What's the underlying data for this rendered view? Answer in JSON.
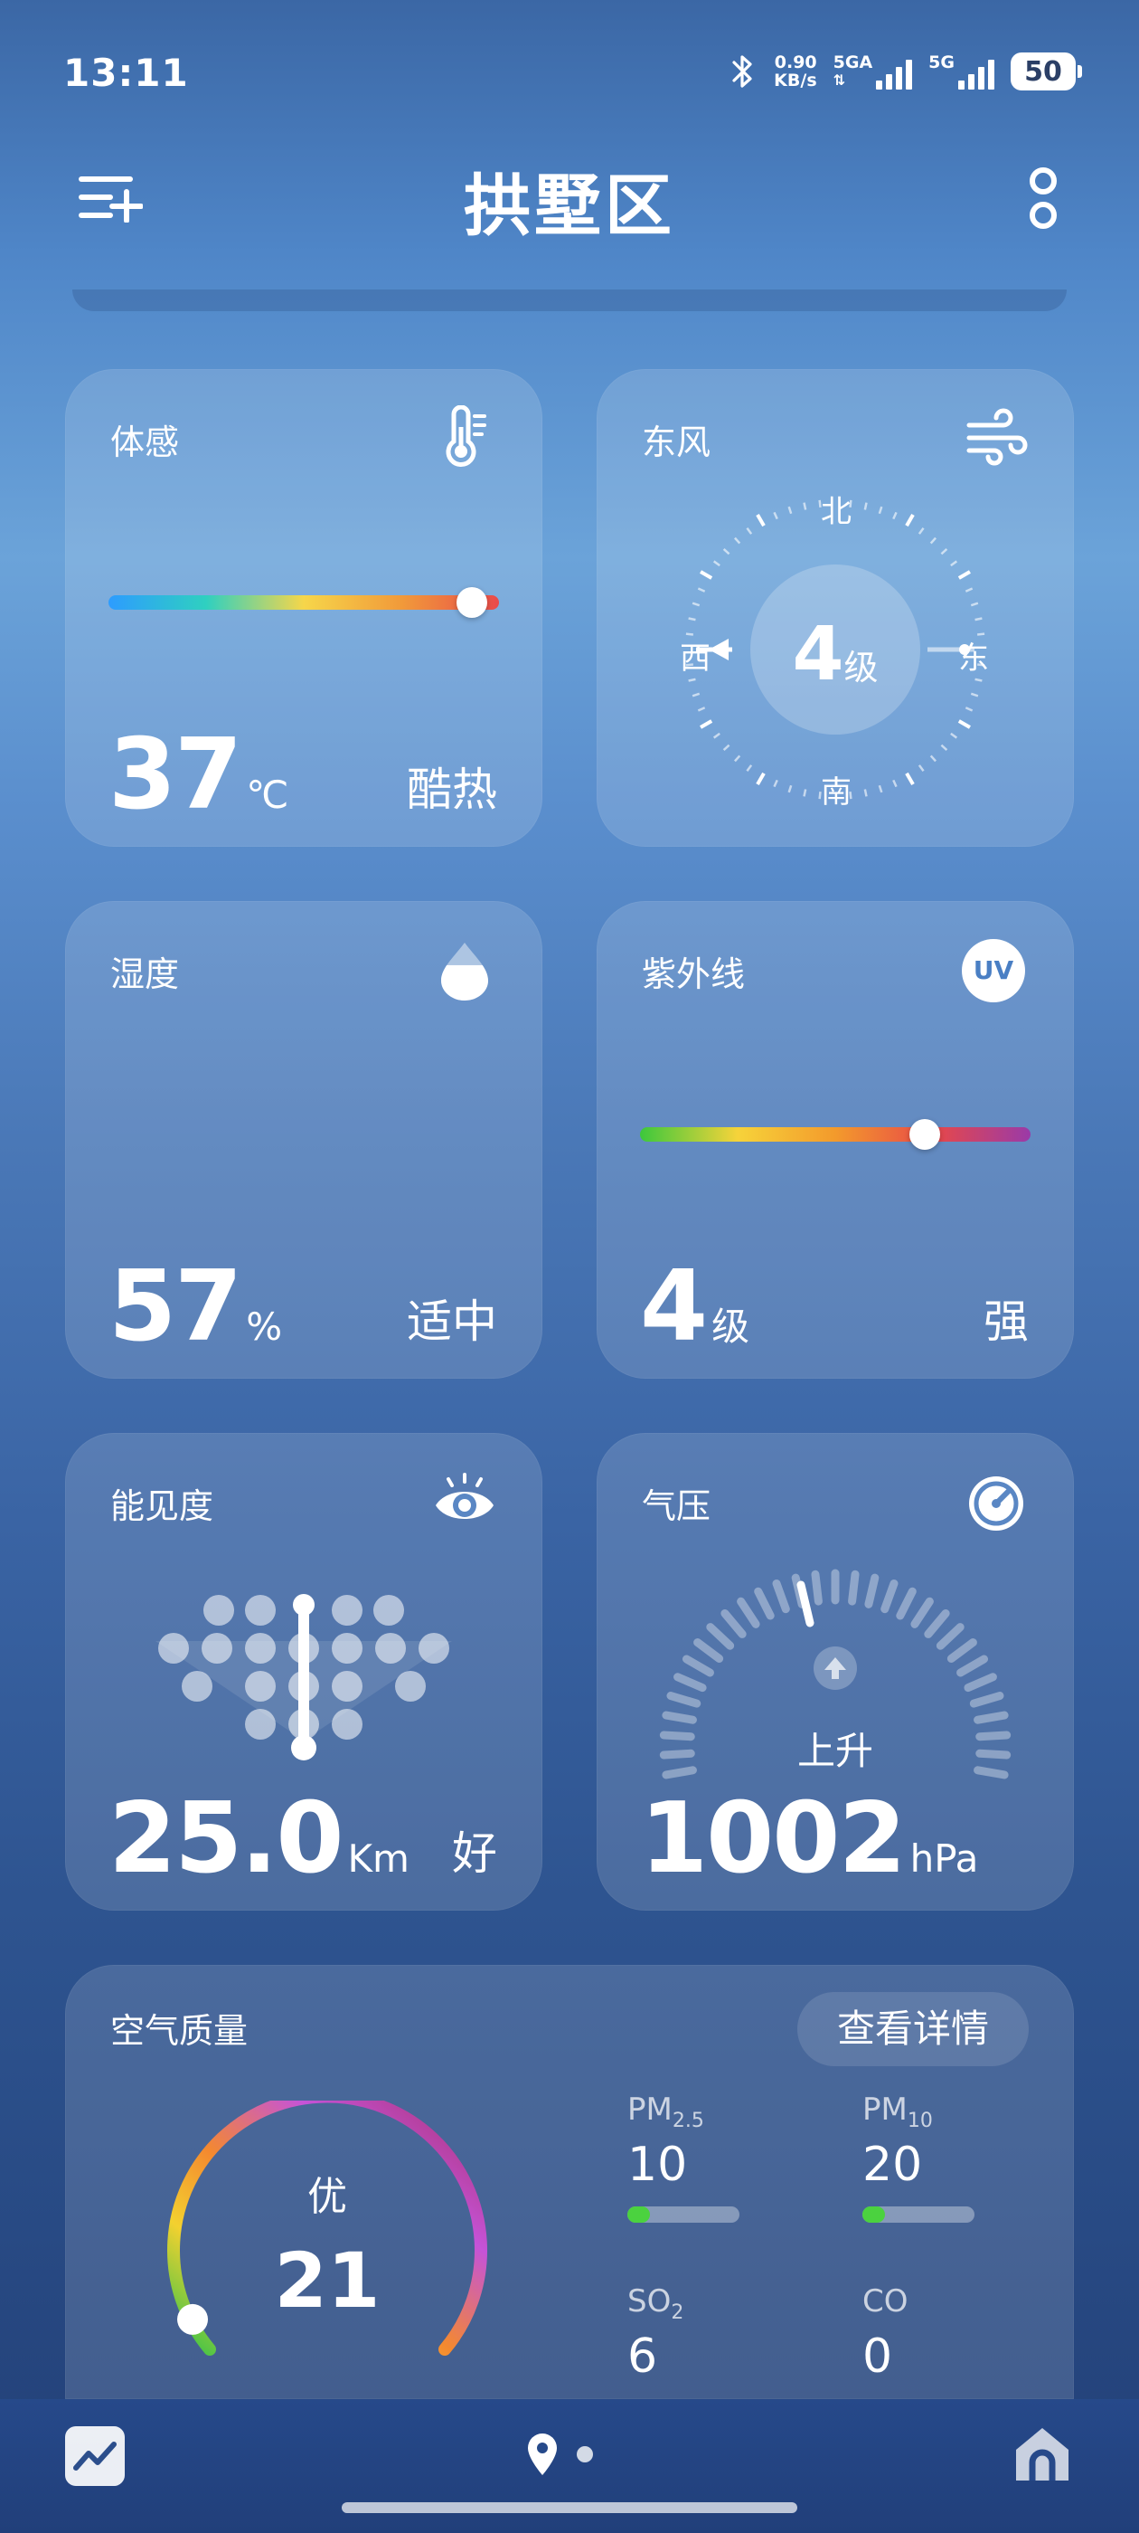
{
  "status_bar": {
    "time": "13:11",
    "net_speed_value": "0.90",
    "net_speed_unit": "KB/s",
    "sim1_label": "5GA",
    "sim2_label": "5G",
    "battery": "50",
    "icons": [
      "bluetooth-icon",
      "signal-icon",
      "battery-icon"
    ]
  },
  "header": {
    "city": "拱墅区",
    "menu_icon": "add-city-menu-icon",
    "more_icon": "more-options-icon"
  },
  "feels_like": {
    "title": "体感",
    "value": "37",
    "unit": "℃",
    "description": "酷热",
    "level_fraction": 0.93,
    "icon": "thermometer-icon"
  },
  "wind": {
    "title": "东风",
    "level": "4",
    "level_unit": "级",
    "north": "北",
    "south": "南",
    "west": "西",
    "east": "东",
    "icon": "wind-icon"
  },
  "humidity": {
    "title": "湿度",
    "value": "57",
    "unit": "%",
    "description": "适中",
    "fill_fraction": 0.57,
    "icon": "water-drop-icon"
  },
  "uv": {
    "title": "紫外线",
    "value": "4",
    "unit": "级",
    "description": "强",
    "level_fraction": 0.73,
    "icon_text": "UV"
  },
  "visibility": {
    "title": "能见度",
    "value": "25.0",
    "unit": "Km",
    "description": "好",
    "icon": "eye-icon"
  },
  "pressure": {
    "title": "气压",
    "value": "1002",
    "unit": "hPa",
    "trend": "上升",
    "icon": "gauge-icon"
  },
  "air_quality": {
    "title": "空气质量",
    "detail_button": "查看详情",
    "level": "优",
    "aqi": "21",
    "gauge_fraction": 0.04,
    "pollutants": [
      {
        "name": "PM",
        "sub": "2.5",
        "value": "10",
        "fraction": 0.2
      },
      {
        "name": "PM",
        "sub": "10",
        "value": "20",
        "fraction": 0.2
      },
      {
        "name": "SO",
        "sub": "2",
        "value": "6"
      },
      {
        "name": "CO",
        "sub": "",
        "value": "0"
      }
    ]
  },
  "bottom_nav": {
    "icons": [
      "trend-chart-icon",
      "location-pin-icon",
      "home-icon"
    ]
  }
}
